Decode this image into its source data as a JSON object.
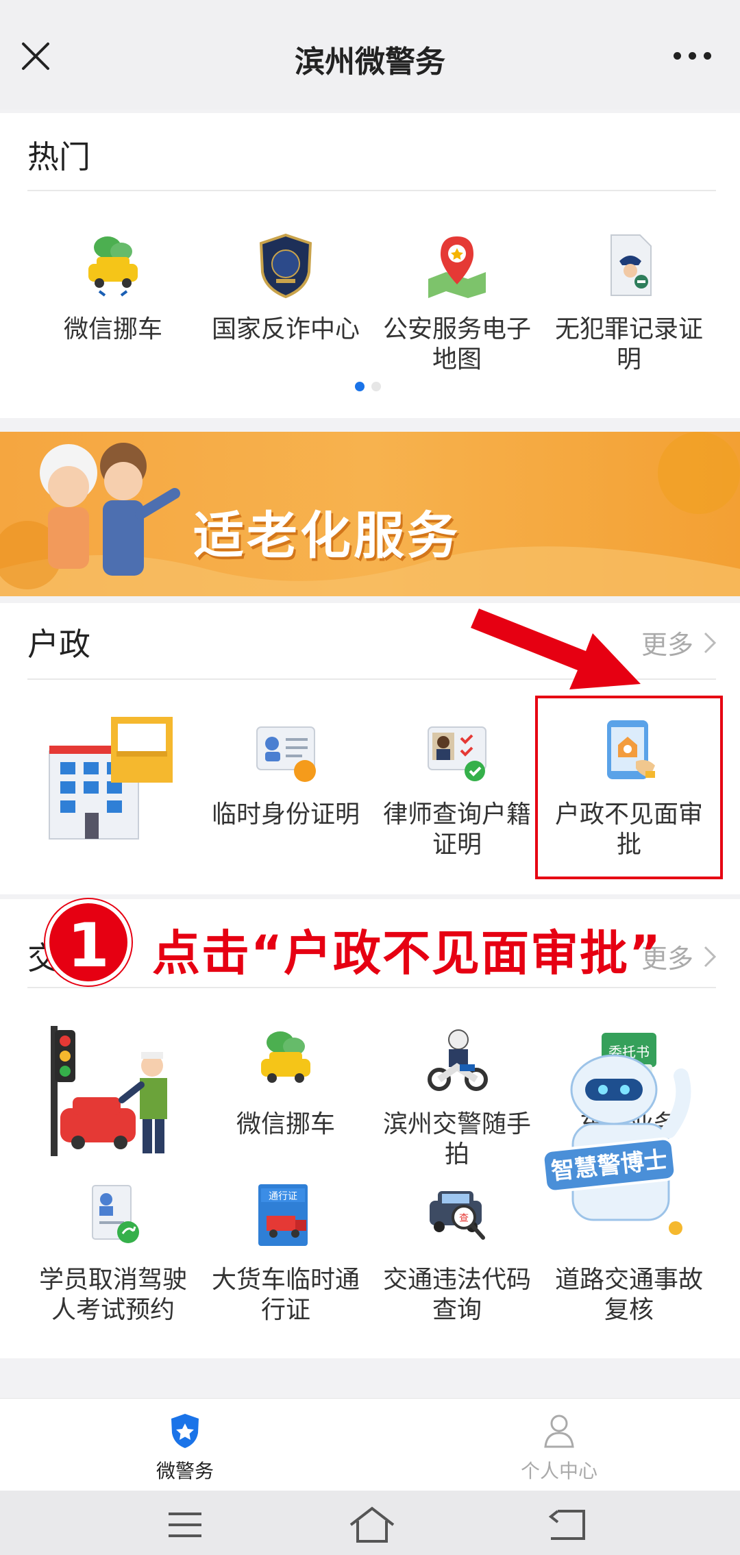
{
  "header": {
    "title": "滨州微警务"
  },
  "hot": {
    "title": "热门",
    "items": [
      {
        "label": "微信挪车",
        "icon": "car-wechat-icon"
      },
      {
        "label": "国家反诈中心",
        "icon": "anti-fraud-shield-icon"
      },
      {
        "label": "公安服务电子地图",
        "icon": "map-pin-icon"
      },
      {
        "label": "无犯罪记录证明",
        "icon": "police-certificate-icon"
      }
    ]
  },
  "banner": {
    "text": "适老化服务"
  },
  "huzheng": {
    "title": "户政",
    "more": "更多",
    "items": [
      {
        "label": "临时身份证明",
        "icon": "temp-id-icon"
      },
      {
        "label": "律师查询户籍证明",
        "icon": "lawyer-query-icon"
      },
      {
        "label": "户政不见面审批",
        "icon": "remote-approval-icon"
      }
    ]
  },
  "annotation": {
    "step": "1",
    "text": "点击“户政不见面审批”"
  },
  "traffic": {
    "title": "交",
    "more": "更多",
    "row1": [
      {
        "label": "微信挪车",
        "icon": "car-wechat-icon"
      },
      {
        "label": "滨州交警随手拍",
        "icon": "traffic-police-moto-icon"
      },
      {
        "label": "车管业务",
        "icon": "vehicle-admin-icon",
        "badge": "委托书"
      }
    ],
    "row2": [
      {
        "label": "学员取消驾驶人考试预约",
        "icon": "cancel-exam-icon"
      },
      {
        "label": "大货车临时通行证",
        "icon": "truck-pass-icon",
        "badge": "通行证"
      },
      {
        "label": "交通违法代码查询",
        "icon": "violation-code-icon",
        "badge": "查"
      },
      {
        "label": "道路交通事故复核",
        "icon": "accident-review-icon"
      }
    ]
  },
  "robot": {
    "text": "智慧警博士"
  },
  "tabs": [
    {
      "label": "微警务",
      "icon": "shield-star-icon",
      "active": true
    },
    {
      "label": "个人中心",
      "icon": "person-icon",
      "active": false
    }
  ],
  "colors": {
    "accent": "#1a73e8",
    "highlight": "#e60012",
    "banner": "#f5a640"
  }
}
